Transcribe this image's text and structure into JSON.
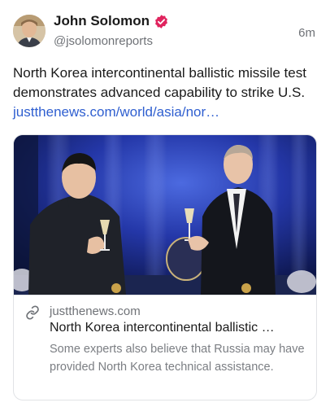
{
  "post": {
    "author_name": "John Solomon",
    "handle": "@jsolomonreports",
    "timestamp": "6m",
    "text": "North Korea intercontinental ballistic missile test demonstrates advanced capability to strike U.S. ",
    "link_text": "justthenews.com/world/asia/nor…",
    "verified_color": "#e0245e"
  },
  "link_card": {
    "image_alt": "Photo: two leaders toasting with champagne glasses in front of a blue backdrop",
    "domain": "justthenews.com",
    "title": "North Korea intercontinental ballistic …",
    "description": "Some experts also believe that Russia may have provided North Korea technical assistance."
  }
}
